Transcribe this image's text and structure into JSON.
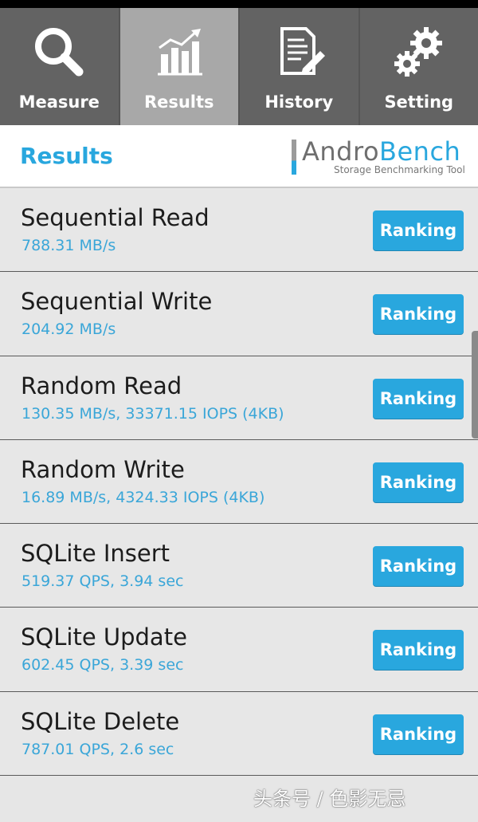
{
  "tabs": [
    {
      "label": "Measure",
      "icon": "search-icon"
    },
    {
      "label": "Results",
      "icon": "bar-chart-icon",
      "active": true
    },
    {
      "label": "History",
      "icon": "document-edit-icon"
    },
    {
      "label": "Setting",
      "icon": "gears-icon"
    }
  ],
  "header": {
    "title": "Results",
    "logo": {
      "brand_part1": "Andro",
      "brand_part2": "Bench",
      "tagline": "Storage Benchmarking Tool"
    }
  },
  "results": [
    {
      "name": "Sequential Read",
      "value": "788.31 MB/s",
      "button": "Ranking"
    },
    {
      "name": "Sequential Write",
      "value": "204.92 MB/s",
      "button": "Ranking"
    },
    {
      "name": "Random Read",
      "value": "130.35 MB/s, 33371.15 IOPS (4KB)",
      "button": "Ranking"
    },
    {
      "name": "Random Write",
      "value": "16.89 MB/s, 4324.33 IOPS (4KB)",
      "button": "Ranking"
    },
    {
      "name": "SQLite Insert",
      "value": "519.37 QPS, 3.94 sec",
      "button": "Ranking"
    },
    {
      "name": "SQLite Update",
      "value": "602.45 QPS, 3.39 sec",
      "button": "Ranking"
    },
    {
      "name": "SQLite Delete",
      "value": "787.01 QPS, 2.6 sec",
      "button": "Ranking"
    }
  ],
  "watermark": "头条号 / 色影无忌",
  "colors": {
    "accent": "#29a7de",
    "tab_bg": "#636363",
    "tab_active_bg": "#a8a8a8",
    "row_bg": "#e7e7e7"
  }
}
